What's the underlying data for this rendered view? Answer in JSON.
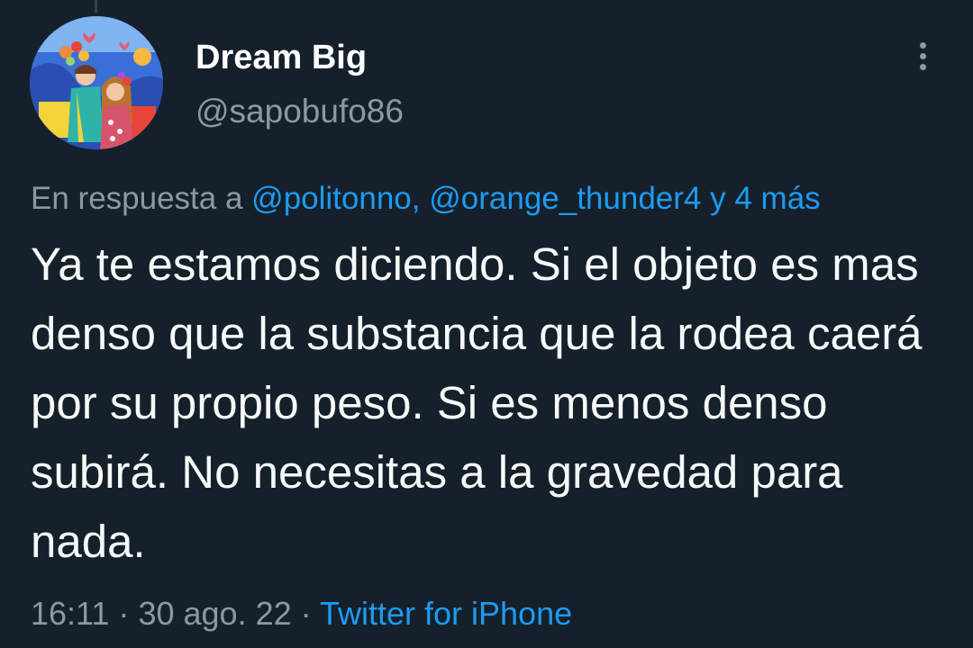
{
  "tweet": {
    "author": {
      "display_name": "Dream Big",
      "handle": "@sapobufo86",
      "avatar": "avatar-illustration"
    },
    "more_icon": "more-vertical-icon",
    "reply_context": {
      "prefix": "En respuesta a",
      "mentions": [
        "@politonno,",
        "@orange_thunder4"
      ],
      "suffix": "y 4 más"
    },
    "text": "Ya te estamos diciendo. Si el objeto es mas denso que la substancia que la rodea caerá por su propio peso. Si es menos denso subirá. No necesitas a la gravedad para nada.",
    "time": "16:11",
    "separator": "·",
    "date": "30 ago. 22",
    "source": "Twitter for iPhone"
  },
  "colors": {
    "background": "#15202b",
    "primary_text": "#f7f9f9",
    "secondary_text": "#8b98a5",
    "link": "#1d9bf0"
  }
}
